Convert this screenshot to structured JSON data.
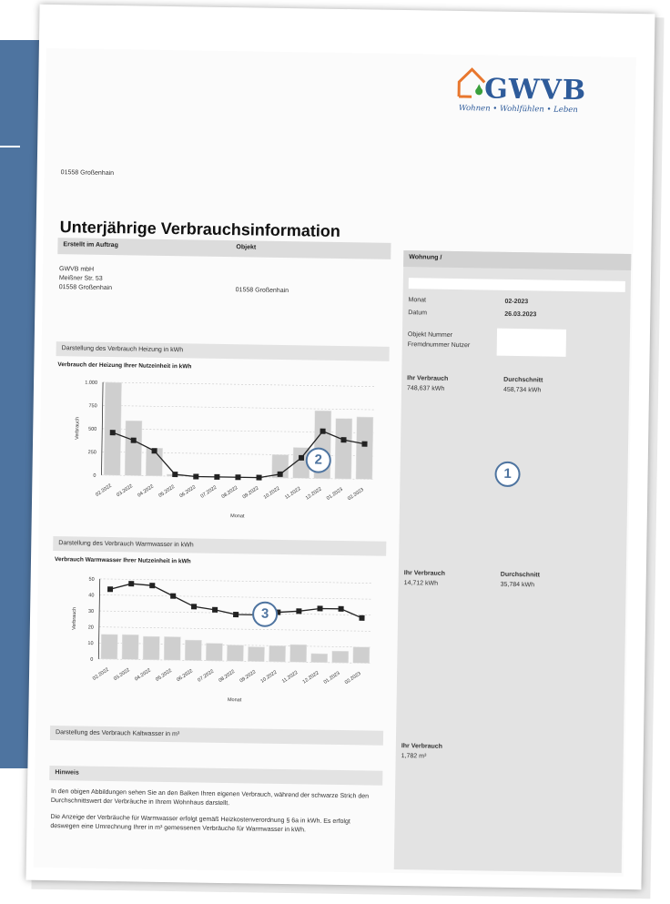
{
  "logo": {
    "text": "GWVB",
    "tagline": "Wohnen • Wohlfühlen • Leben"
  },
  "address_line": "01558 Großenhain",
  "title": "Unterjährige Verbrauchsinformation",
  "header": {
    "erstellt": "Erstellt im Auftrag",
    "objekt": "Objekt",
    "wohnung": "Wohnung /"
  },
  "sender": {
    "line1": "GWVB mbH",
    "line2": "Meißner Str. 53",
    "line3": "01558 Großenhain"
  },
  "objekt_value": "01558 Großenhain",
  "info": {
    "monat_label": "Monat",
    "monat_value": "02-2023",
    "datum_label": "Datum",
    "datum_value": "26.03.2023",
    "objekt_nummer_label": "Objekt Nummer",
    "fremdnummer_label": "Fremdnummer Nutzer"
  },
  "heizung": {
    "section": "Darstellung des Verbrauch Heizung in kWh",
    "chart_title": "Verbrauch der Heizung Ihrer Nutzeinheit in kWh",
    "ihr_label": "Ihr Verbrauch",
    "ihr_value": "748,637 kWh",
    "avg_label": "Durchschnitt",
    "avg_value": "458,734 kWh"
  },
  "warmwasser": {
    "section": "Darstellung des Verbrauch Warmwasser in kWh",
    "chart_title": "Verbrauch Warmwasser Ihrer Nutzeinheit in kWh",
    "ihr_label": "Ihr Verbrauch",
    "ihr_value": "14,712 kWh",
    "avg_label": "Durchschnitt",
    "avg_value": "35,784 kWh"
  },
  "kaltwasser": {
    "section": "Darstellung des Verbrauch Kaltwasser in m³",
    "ihr_label": "Ihr Verbrauch",
    "ihr_value": "1,782 m³"
  },
  "hinweis": {
    "title": "Hinweis",
    "p1": "In den obigen Abbildungen sehen Sie an den Balken Ihren eigenen Verbrauch, während der schwarze Strich den Durchschnittswert der Verbräuche in Ihrem Wohnhaus darstellt.",
    "p2": "Die Anzeige der Verbräuche für Warmwasser erfolgt gemäß Heizkostenverordnung § 6a in kWh. Es erfolgt deswegen eine Umrechnung Ihrer in m³ gemessenen Verbräuche für Warmwasser in kWh."
  },
  "badges": {
    "b1": "1",
    "b2": "2",
    "b3": "3"
  },
  "colors": {
    "accent": "#4e74a0",
    "logo_blue": "#2e5b9a",
    "logo_orange": "#e8772e",
    "logo_green": "#3aa03c"
  },
  "chart_data": [
    {
      "type": "bar",
      "title": "Verbrauch der Heizung Ihrer Nutzeinheit in kWh",
      "xlabel": "Monat",
      "ylabel": "Verbrauch",
      "ylim": [
        0,
        1000
      ],
      "yticks": [
        "0",
        "250",
        "500",
        "750",
        "1.000"
      ],
      "categories": [
        "02.2022",
        "03.2022",
        "04.2022",
        "05.2022",
        "06.2022",
        "07.2022",
        "08.2022",
        "09.2022",
        "10.2022",
        "11.2022",
        "12.2022",
        "01.2023",
        "02.2023"
      ],
      "series": [
        {
          "kind": "bar",
          "values": [
            1000,
            590,
            300,
            20,
            0,
            0,
            0,
            0,
            250,
            330,
            730,
            650,
            670
          ]
        },
        {
          "kind": "line",
          "values": [
            460,
            380,
            270,
            20,
            0,
            0,
            0,
            0,
            40,
            220,
            510,
            420,
            380
          ]
        }
      ]
    },
    {
      "type": "bar",
      "title": "Verbrauch Warmwasser Ihrer Nutzeinheit in kWh",
      "xlabel": "Monat",
      "ylabel": "Verbrauch",
      "ylim": [
        0,
        55
      ],
      "yticks": [
        "0",
        "10",
        "20",
        "30",
        "40",
        "50"
      ],
      "categories": [
        "02.2022",
        "03.2022",
        "04.2022",
        "05.2022",
        "06.2022",
        "07.2022",
        "08.2022",
        "09.2022",
        "10.2022",
        "11.2022",
        "12.2022",
        "01.2023",
        "02.2023"
      ],
      "series": [
        {
          "kind": "bar",
          "values": [
            17,
            17,
            16,
            16,
            14,
            12,
            11,
            10,
            11,
            12,
            6,
            8,
            11
          ]
        },
        {
          "kind": "line",
          "values": [
            48,
            52,
            51,
            44,
            37,
            35,
            32,
            32,
            34,
            35,
            37,
            37,
            31
          ]
        }
      ]
    }
  ]
}
